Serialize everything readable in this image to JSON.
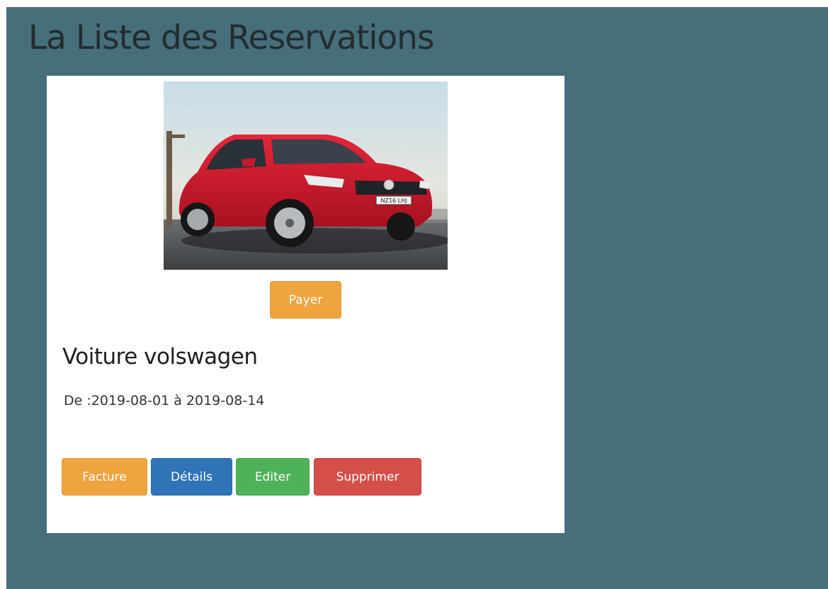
{
  "header": {
    "title": "La Liste des Reservations"
  },
  "reservation": {
    "image": {
      "alt": "Voiture volswagen rouge",
      "plate": "NZ16 LHJ"
    },
    "pay_label": "Payer",
    "car_title": "Voiture volswagen",
    "dates": "De :2019-08-01 à 2019-08-14",
    "actions": {
      "facture": "Facture",
      "details": "Détails",
      "editer": "Editer",
      "supprimer": "Supprimer"
    }
  },
  "colors": {
    "background": "#466e7b",
    "warning": "#eea43f",
    "primary": "#2f74b8",
    "success": "#4fb259",
    "danger": "#d44e4a"
  }
}
